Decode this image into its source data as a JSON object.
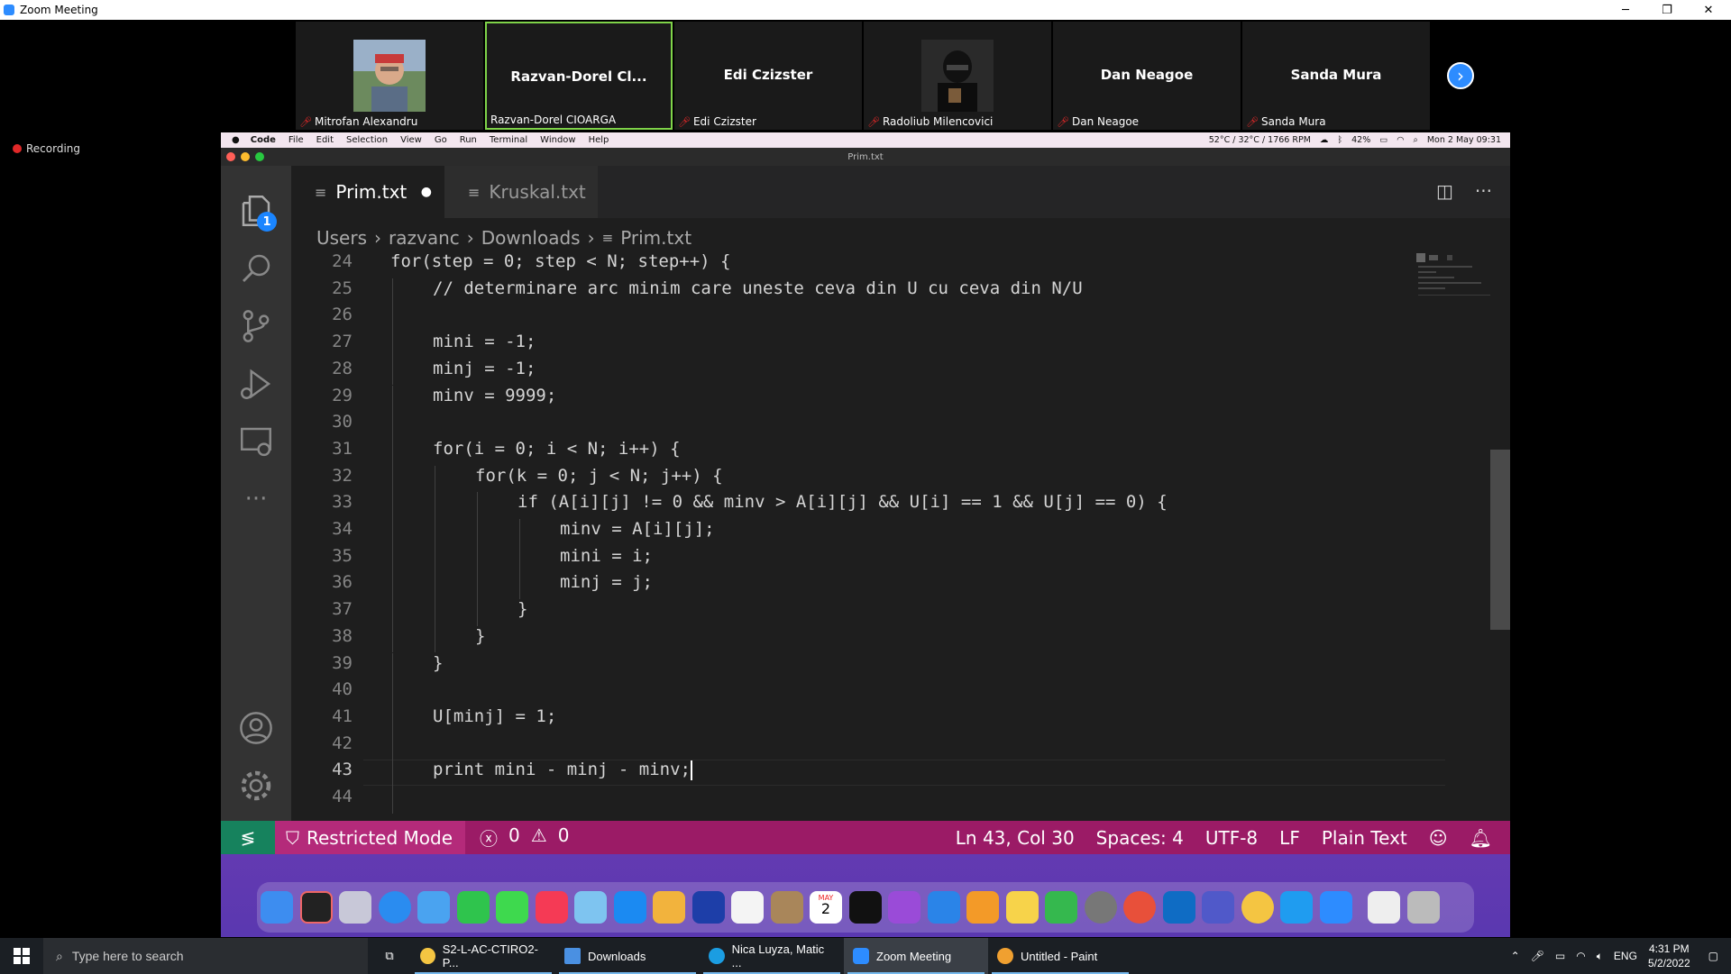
{
  "zoom": {
    "window_title": "Zoom Meeting",
    "recording_label": "Recording",
    "participants": [
      {
        "name": "Mitrofan Alexandru",
        "display": "",
        "has_video": true
      },
      {
        "name": "Razvan-Dorel CIOARGA",
        "display": "Razvan-Dorel  Cl...",
        "has_video": false,
        "active": true
      },
      {
        "name": "Edi Czizster",
        "display": "Edi Czizster",
        "has_video": false
      },
      {
        "name": "Radoliub Milencovici",
        "display": "",
        "has_video": true
      },
      {
        "name": "Dan Neagoe",
        "display": "Dan Neagoe",
        "has_video": false
      },
      {
        "name": "Sanda Mura",
        "display": "Sanda Mura",
        "has_video": false
      }
    ]
  },
  "mac_menubar": {
    "app": "Code",
    "menus": [
      "File",
      "Edit",
      "Selection",
      "View",
      "Go",
      "Run",
      "Terminal",
      "Window",
      "Help"
    ],
    "weather": "52°C / 32°C / 1766 RPM",
    "battery": "42%",
    "datetime": "Mon 2 May 09:31"
  },
  "vscode": {
    "window_title": "Prim.txt",
    "explorer_badge": "1",
    "tabs": [
      {
        "label": "Prim.txt",
        "active": true,
        "modified": true
      },
      {
        "label": "Kruskal.txt",
        "active": false,
        "modified": false
      }
    ],
    "breadcrumb": [
      "Users",
      "razvanc",
      "Downloads",
      "Prim.txt"
    ],
    "lines": [
      {
        "n": "24",
        "indent": 0,
        "text": "for(step = 0; step < N; step++) {"
      },
      {
        "n": "25",
        "indent": 1,
        "text": "// determinare arc minim care uneste ceva din U cu ceva din N/U"
      },
      {
        "n": "26",
        "indent": 1,
        "text": ""
      },
      {
        "n": "27",
        "indent": 1,
        "text": "mini = -1;"
      },
      {
        "n": "28",
        "indent": 1,
        "text": "minj = -1;"
      },
      {
        "n": "29",
        "indent": 1,
        "text": "minv = 9999;"
      },
      {
        "n": "30",
        "indent": 1,
        "text": ""
      },
      {
        "n": "31",
        "indent": 1,
        "text": "for(i = 0; i < N; i++) {"
      },
      {
        "n": "32",
        "indent": 2,
        "text": "for(k = 0; j < N; j++) {"
      },
      {
        "n": "33",
        "indent": 3,
        "text": "if (A[i][j] != 0 && minv > A[i][j] && U[i] == 1 && U[j] == 0) {"
      },
      {
        "n": "34",
        "indent": 4,
        "text": "minv = A[i][j];"
      },
      {
        "n": "35",
        "indent": 4,
        "text": "mini = i;"
      },
      {
        "n": "36",
        "indent": 4,
        "text": "minj = j;"
      },
      {
        "n": "37",
        "indent": 3,
        "text": "}"
      },
      {
        "n": "38",
        "indent": 2,
        "text": "}"
      },
      {
        "n": "39",
        "indent": 1,
        "text": "}"
      },
      {
        "n": "40",
        "indent": 1,
        "text": ""
      },
      {
        "n": "41",
        "indent": 1,
        "text": "U[minj] = 1;"
      },
      {
        "n": "42",
        "indent": 1,
        "text": ""
      },
      {
        "n": "43",
        "indent": 1,
        "text": "print mini - minj - minv;"
      },
      {
        "n": "44",
        "indent": 1,
        "text": ""
      }
    ],
    "current_line": "43",
    "status": {
      "mode": "Restricted Mode",
      "errors": "0",
      "warnings": "0",
      "position": "Ln 43, Col 30",
      "spaces": "Spaces: 4",
      "encoding": "UTF-8",
      "eol": "LF",
      "language": "Plain Text"
    }
  },
  "dock": {
    "calendar_month": "MAY",
    "calendar_day": "2"
  },
  "taskbar": {
    "search_placeholder": "Type here to search",
    "apps": [
      "S2-L-AC-CTIRO2-P...",
      "Downloads",
      "Nica Luyza, Matic ...",
      "Zoom Meeting",
      "Untitled - Paint"
    ],
    "language": "ENG",
    "time": "4:31 PM",
    "date": "5/2/2022"
  }
}
